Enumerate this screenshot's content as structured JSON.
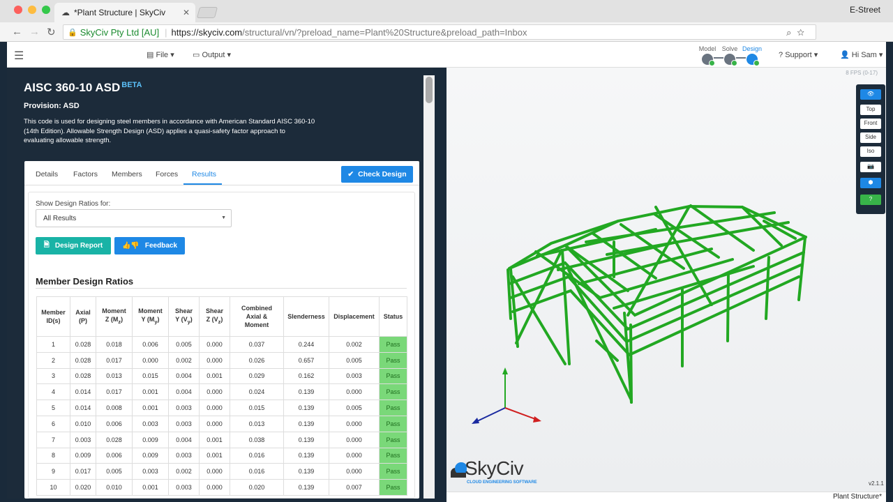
{
  "browser": {
    "tab_title": "*Plant Structure | SkyCiv",
    "tab_close": "✕",
    "profile": "E-Street",
    "secure_label": "SkyCiv Pty Ltd [AU]",
    "url_host": "https://skyciv.com",
    "url_path": "/structural/vn/?preload_name=Plant%20Structure&preload_path=Inbox"
  },
  "appbar": {
    "file": "File",
    "output": "Output",
    "support": "Support",
    "user": "Hi Sam",
    "steps": [
      {
        "label": "Model"
      },
      {
        "label": "Solve"
      },
      {
        "label": "Design"
      }
    ]
  },
  "panel": {
    "title": "AISC 360-10 ASD",
    "badge": "BETA",
    "provision": "Provision: ASD",
    "description": "This code is used for designing steel members in accordance with American Standard AISC 360-10 (14th Edition). Allowable Strength Design (ASD) applies a quasi-safety factor approach to evaluating allowable strength.",
    "tabs": [
      "Details",
      "Factors",
      "Members",
      "Forces",
      "Results"
    ],
    "active_tab": "Results",
    "check_design": "Check Design",
    "show_label": "Show Design Ratios for:",
    "select_value": "All Results",
    "design_report": "Design Report",
    "feedback": "Feedback",
    "section_title": "Member Design Ratios"
  },
  "table": {
    "rows": [
      [
        "1",
        "0.028",
        "0.018",
        "0.006",
        "0.005",
        "0.000",
        "0.037",
        "0.244",
        "0.002",
        "Pass"
      ],
      [
        "2",
        "0.028",
        "0.017",
        "0.000",
        "0.002",
        "0.000",
        "0.026",
        "0.657",
        "0.005",
        "Pass"
      ],
      [
        "3",
        "0.028",
        "0.013",
        "0.015",
        "0.004",
        "0.001",
        "0.029",
        "0.162",
        "0.003",
        "Pass"
      ],
      [
        "4",
        "0.014",
        "0.017",
        "0.001",
        "0.004",
        "0.000",
        "0.024",
        "0.139",
        "0.000",
        "Pass"
      ],
      [
        "5",
        "0.014",
        "0.008",
        "0.001",
        "0.003",
        "0.000",
        "0.015",
        "0.139",
        "0.005",
        "Pass"
      ],
      [
        "6",
        "0.010",
        "0.006",
        "0.003",
        "0.003",
        "0.000",
        "0.013",
        "0.139",
        "0.000",
        "Pass"
      ],
      [
        "7",
        "0.003",
        "0.028",
        "0.009",
        "0.004",
        "0.001",
        "0.038",
        "0.139",
        "0.000",
        "Pass"
      ],
      [
        "8",
        "0.009",
        "0.006",
        "0.009",
        "0.003",
        "0.001",
        "0.016",
        "0.139",
        "0.000",
        "Pass"
      ],
      [
        "9",
        "0.017",
        "0.005",
        "0.003",
        "0.002",
        "0.000",
        "0.016",
        "0.139",
        "0.000",
        "Pass"
      ],
      [
        "10",
        "0.020",
        "0.010",
        "0.001",
        "0.003",
        "0.000",
        "0.020",
        "0.139",
        "0.007",
        "Pass"
      ]
    ]
  },
  "viewport": {
    "fps": "8 FPS (0-17)",
    "buttons": [
      "Top",
      "Front",
      "Side",
      "Iso"
    ],
    "logo": "SkyCiv",
    "logo_sub": "CLOUD ENGINEERING SOFTWARE",
    "version": "v2.1.1",
    "status": "Plant Structure*",
    "colors": {
      "structure": "#22a822",
      "accent": "#1e88e5",
      "panel": "#1c2b3a",
      "pass": "#7ad879"
    }
  }
}
